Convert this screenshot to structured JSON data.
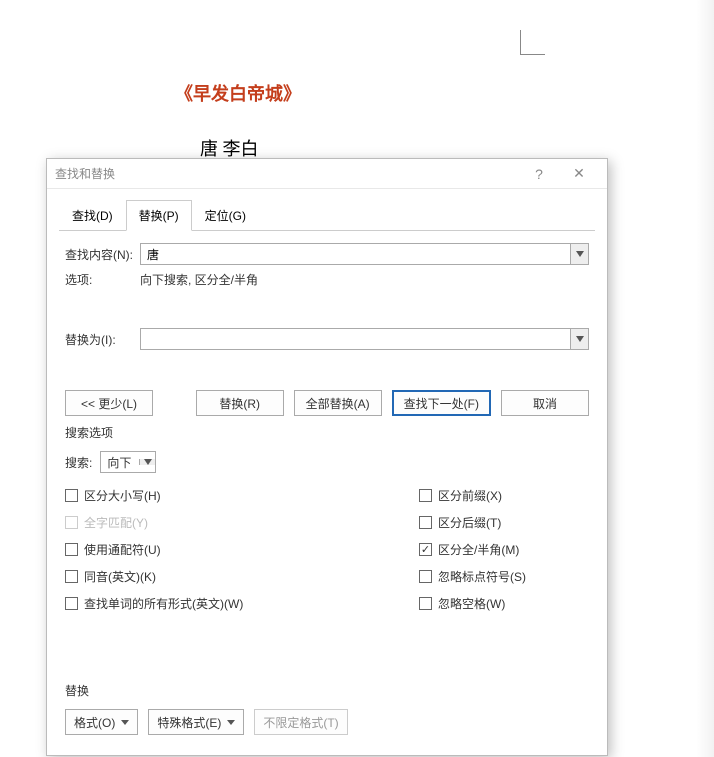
{
  "document": {
    "title": "《早发白帝城》",
    "author": "唐 李白"
  },
  "dialog": {
    "title": "查找和替换",
    "help": "?",
    "close": "✕",
    "tabs": {
      "find": "查找(D)",
      "replace": "替换(P)",
      "goto": "定位(G)"
    },
    "fields": {
      "find_label": "查找内容(N):",
      "find_value": "唐",
      "options_label": "选项:",
      "options_value": "向下搜索, 区分全/半角",
      "replace_label": "替换为(I):",
      "replace_value": ""
    },
    "buttons": {
      "less": "<< 更少(L)",
      "replace": "替换(R)",
      "replace_all": "全部替换(A)",
      "find_next": "查找下一处(F)",
      "cancel": "取消"
    },
    "search_options": {
      "section": "搜索选项",
      "search_label": "搜索:",
      "direction": "向下",
      "left": [
        {
          "key": "case",
          "label": "区分大小写(H)",
          "checked": false,
          "disabled": false
        },
        {
          "key": "whole",
          "label": "全字匹配(Y)",
          "checked": false,
          "disabled": true
        },
        {
          "key": "wildcard",
          "label": "使用通配符(U)",
          "checked": false,
          "disabled": false
        },
        {
          "key": "homophone",
          "label": "同音(英文)(K)",
          "checked": false,
          "disabled": false
        },
        {
          "key": "allforms",
          "label": "查找单词的所有形式(英文)(W)",
          "checked": false,
          "disabled": false
        }
      ],
      "right": [
        {
          "key": "prefix",
          "label": "区分前缀(X)",
          "checked": false,
          "disabled": false
        },
        {
          "key": "suffix",
          "label": "区分后缀(T)",
          "checked": false,
          "disabled": false
        },
        {
          "key": "fullhalf",
          "label": "区分全/半角(M)",
          "checked": true,
          "disabled": false
        },
        {
          "key": "punct",
          "label": "忽略标点符号(S)",
          "checked": false,
          "disabled": false
        },
        {
          "key": "space",
          "label": "忽略空格(W)",
          "checked": false,
          "disabled": false
        }
      ]
    },
    "bottom": {
      "section": "替换",
      "format": "格式(O)",
      "special": "特殊格式(E)",
      "noformat": "不限定格式(T)"
    }
  }
}
